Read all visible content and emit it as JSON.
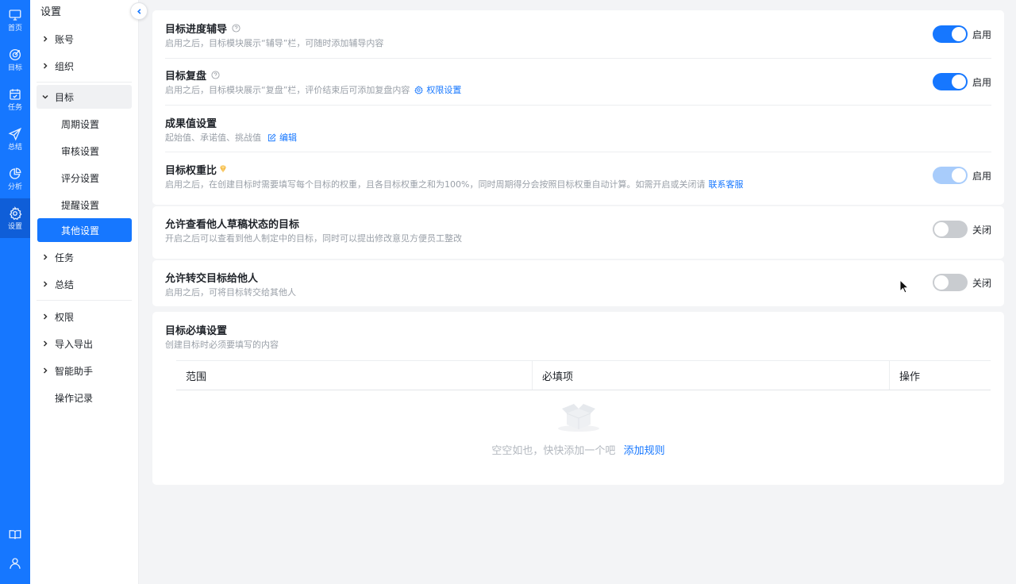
{
  "rail": [
    {
      "icon": "monitor-icon",
      "label": "首页"
    },
    {
      "icon": "target-icon",
      "label": "目标"
    },
    {
      "icon": "calendar-check-icon",
      "label": "任务"
    },
    {
      "icon": "send-icon",
      "label": "总结"
    },
    {
      "icon": "pie-chart-icon",
      "label": "分析"
    },
    {
      "icon": "gear-icon",
      "label": "设置",
      "active": true
    }
  ],
  "rail_bottom": [
    "book-icon",
    "user-icon"
  ],
  "menu": {
    "title": "设置",
    "account": "账号",
    "org": "组织",
    "goal": "目标",
    "goal_subs": [
      "周期设置",
      "审核设置",
      "评分设置",
      "提醒设置",
      "其他设置"
    ],
    "task": "任务",
    "summary": "总结",
    "permission": "权限",
    "import_export": "导入导出",
    "assistant": "智能助手",
    "log": "操作记录"
  },
  "settings": {
    "progress": {
      "title": "目标进度辅导",
      "desc": "启用之后，目标模块展示“辅导”栏，可随时添加辅导内容",
      "state": "启用"
    },
    "review": {
      "title": "目标复盘",
      "desc": "启用之后，目标模块展示“复盘”栏，评价结束后可添加复盘内容",
      "link": "权限设置",
      "state": "启用"
    },
    "outcome": {
      "title": "成果值设置",
      "desc": "起始值、承诺值、挑战值",
      "link": "编辑"
    },
    "weight": {
      "title": "目标权重比",
      "desc": "启用之后，在创建目标时需要填写每个目标的权重，且各目标权重之和为100%，同时周期得分会按照目标权重自动计算。如需开启或关闭请",
      "link": "联系客服",
      "state": "启用"
    },
    "draft": {
      "title": "允许查看他人草稿状态的目标",
      "desc": "开启之后可以查看到他人制定中的目标，同时可以提出修改意见方便员工整改",
      "state": "关闭"
    },
    "transfer": {
      "title": "允许转交目标给他人",
      "desc": "启用之后，可将目标转交给其他人",
      "state": "关闭"
    }
  },
  "required": {
    "title": "目标必填设置",
    "desc": "创建目标时必须要填写的内容",
    "columns": [
      "范围",
      "必填项",
      "操作"
    ],
    "empty_text": "空空如也，快快添加一个吧",
    "empty_link": "添加规则"
  },
  "colors": {
    "accent": "#1677ff",
    "rail": "#1677ff"
  }
}
